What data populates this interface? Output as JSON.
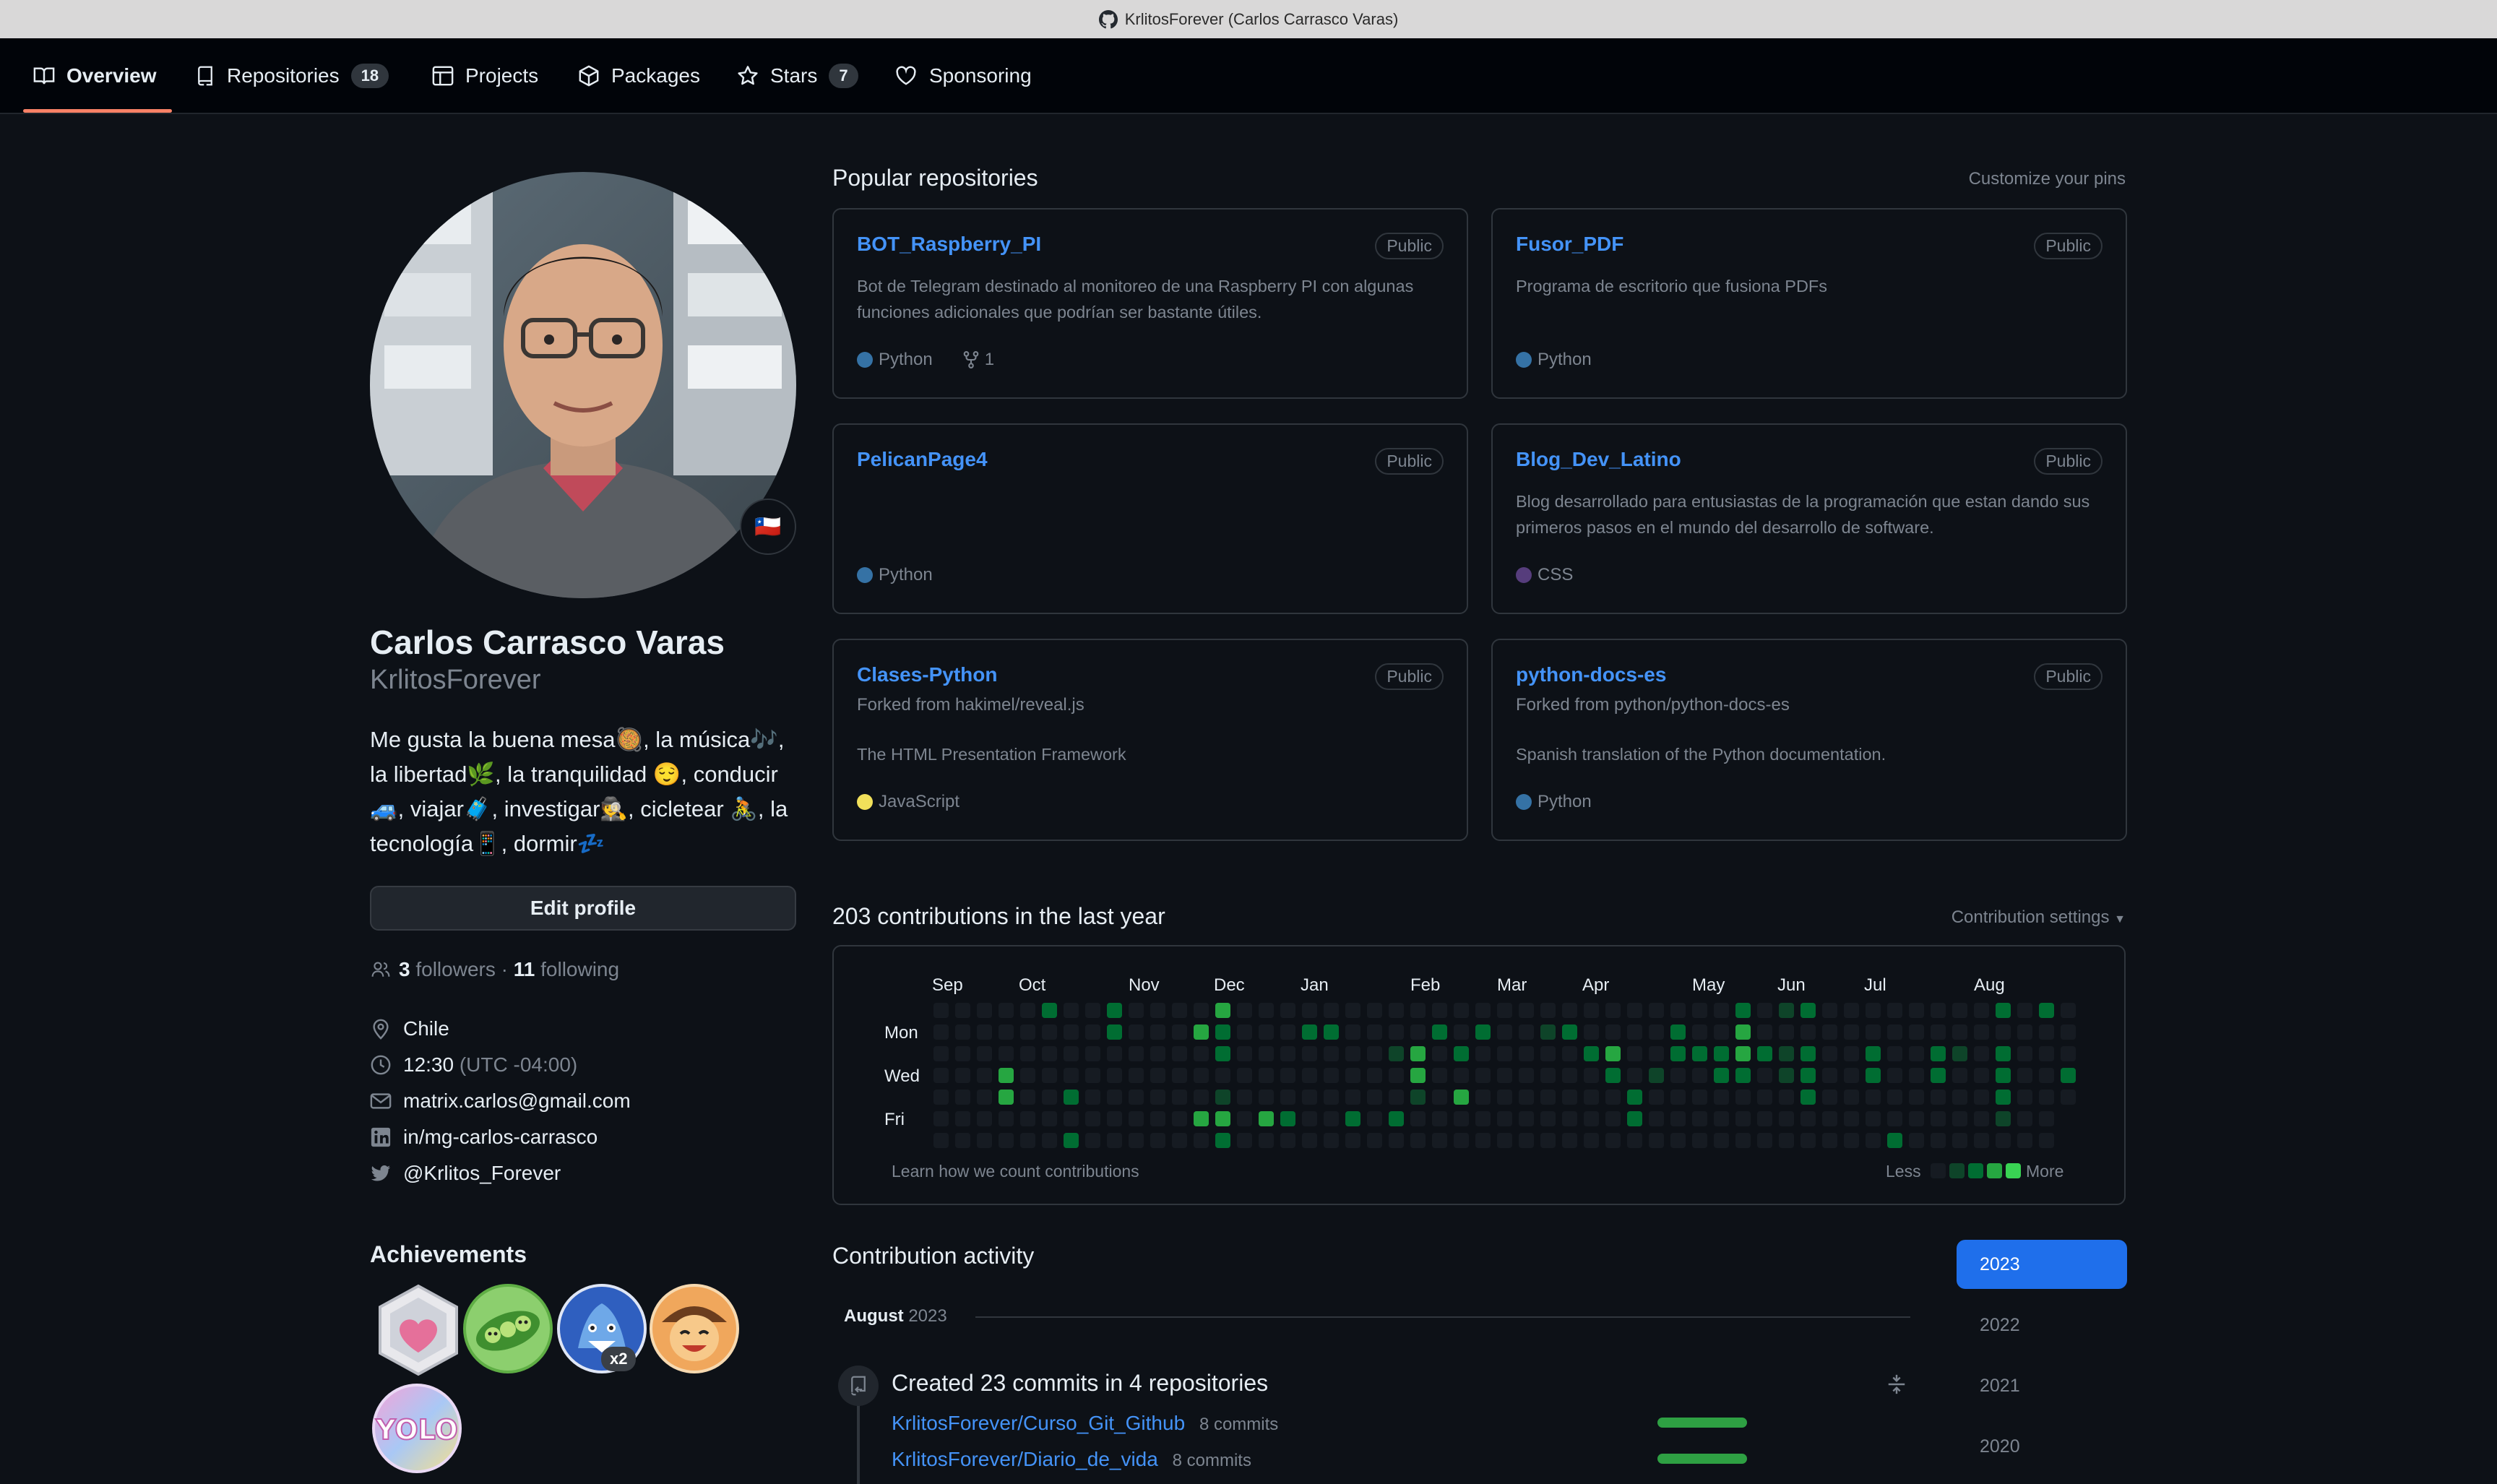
{
  "window": {
    "title": "KrlitosForever (Carlos Carrasco Varas)"
  },
  "nav": {
    "tabs": [
      {
        "label": "Overview"
      },
      {
        "label": "Repositories",
        "count": "18"
      },
      {
        "label": "Projects"
      },
      {
        "label": "Packages"
      },
      {
        "label": "Stars",
        "count": "7"
      },
      {
        "label": "Sponsoring"
      }
    ]
  },
  "profile": {
    "name": "Carlos Carrasco Varas",
    "login": "KrlitosForever",
    "bio": "Me gusta la buena mesa🥘, la música🎶, la libertad🌿, la tranquilidad 😌, conducir🚙, viajar🧳, investigar🕵️, cicletear 🚴, la tecnología📱, dormir💤",
    "edit_label": "Edit profile",
    "followers_count": "3",
    "followers_label": "followers",
    "separator": "·",
    "following_count": "11",
    "following_label": "following",
    "location": "Chile",
    "time": "12:30",
    "timezone": "(UTC -04:00)",
    "email": "matrix.carlos@gmail.com",
    "linkedin": "in/mg-carlos-carrasco",
    "twitter": "@Krlitos_Forever",
    "flag_emoji": "🇨🇱"
  },
  "achievements": {
    "title": "Achievements",
    "badges": [
      {
        "icon": "heart-on-sleeve-icon"
      },
      {
        "icon": "pair-extraordinaire-icon"
      },
      {
        "icon": "pull-shark-icon",
        "multiplier": "x2"
      },
      {
        "icon": "quickdraw-icon"
      },
      {
        "icon": "yolo-icon"
      }
    ]
  },
  "popular": {
    "title": "Popular repositories",
    "customize": "Customize your pins",
    "repos": [
      {
        "name": "BOT_Raspberry_PI",
        "visibility": "Public",
        "description": "Bot de Telegram destinado al monitoreo de una Raspberry PI con algunas funciones adicionales que podrían ser bastante útiles.",
        "language": "Python",
        "lang_color": "#3572a5",
        "forks": "1"
      },
      {
        "name": "Fusor_PDF",
        "visibility": "Public",
        "description": "Programa de escritorio que fusiona PDFs",
        "language": "Python",
        "lang_color": "#3572a5"
      },
      {
        "name": "PelicanPage4",
        "visibility": "Public",
        "description": "",
        "language": "Python",
        "lang_color": "#3572a5"
      },
      {
        "name": "Blog_Dev_Latino",
        "visibility": "Public",
        "description": "Blog desarrollado para entusiastas de la programación que estan dando sus primeros pasos en el mundo del desarrollo de software.",
        "language": "CSS",
        "lang_color": "#563d7c"
      },
      {
        "name": "Clases-Python",
        "visibility": "Public",
        "forked_from": "Forked from hakimel/reveal.js",
        "description": "The HTML Presentation Framework",
        "language": "JavaScript",
        "lang_color": "#f1e05a"
      },
      {
        "name": "python-docs-es",
        "visibility": "Public",
        "forked_from": "Forked from python/python-docs-es",
        "description": "Spanish translation of the Python documentation.",
        "language": "Python",
        "lang_color": "#3572a5"
      }
    ]
  },
  "contributions": {
    "title": "203 contributions in the last year",
    "settings": "Contribution settings",
    "months": [
      "Sep",
      "Oct",
      "Nov",
      "Dec",
      "Jan",
      "Feb",
      "Mar",
      "Apr",
      "May",
      "Jun",
      "Jul",
      "Aug"
    ],
    "days": [
      "Mon",
      "Wed",
      "Fri"
    ],
    "learn": "Learn how we count contributions",
    "less": "Less",
    "more": "More",
    "colors": [
      "#161b22",
      "#0e4429",
      "#006d32",
      "#26a641",
      "#39d353"
    ]
  },
  "activity": {
    "title": "Contribution activity",
    "month": "August",
    "year": "2023",
    "years": [
      "2023",
      "2022",
      "2021",
      "2020"
    ],
    "summary": "Created 23 commits in 4 repositories",
    "items": [
      {
        "repo": "KrlitosForever/Curso_Git_Github",
        "commits": "8 commits"
      },
      {
        "repo": "KrlitosForever/Diario_de_vida",
        "commits": "8 commits"
      }
    ]
  }
}
